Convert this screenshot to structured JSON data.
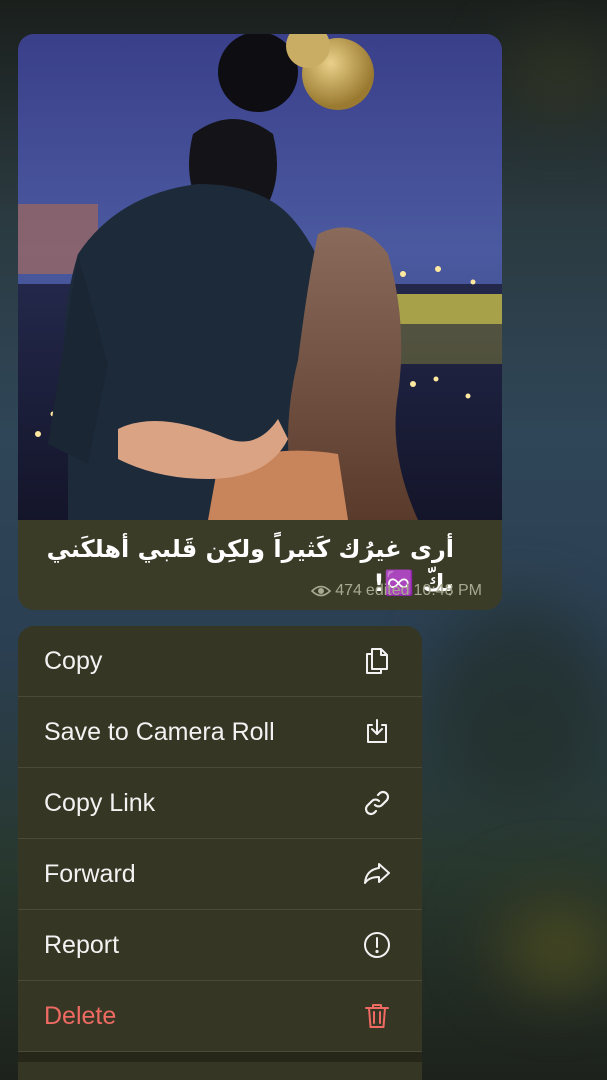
{
  "message": {
    "caption": "أرى غيرُك كَثيراً ولكِن قَلبي أهلكَني بكّ ♾️!",
    "views": "474",
    "edited_label": "edited",
    "time": "10:48 PM"
  },
  "context_menu": {
    "items": [
      {
        "label": "Copy",
        "icon": "copy-icon"
      },
      {
        "label": "Save to Camera Roll",
        "icon": "save-icon"
      },
      {
        "label": "Copy Link",
        "icon": "link-icon"
      },
      {
        "label": "Forward",
        "icon": "forward-icon"
      },
      {
        "label": "Report",
        "icon": "report-icon"
      },
      {
        "label": "Delete",
        "icon": "trash-icon"
      }
    ]
  },
  "colors": {
    "bubble": "#3b3c28",
    "menu": "#363624",
    "danger": "#ee6a62"
  }
}
